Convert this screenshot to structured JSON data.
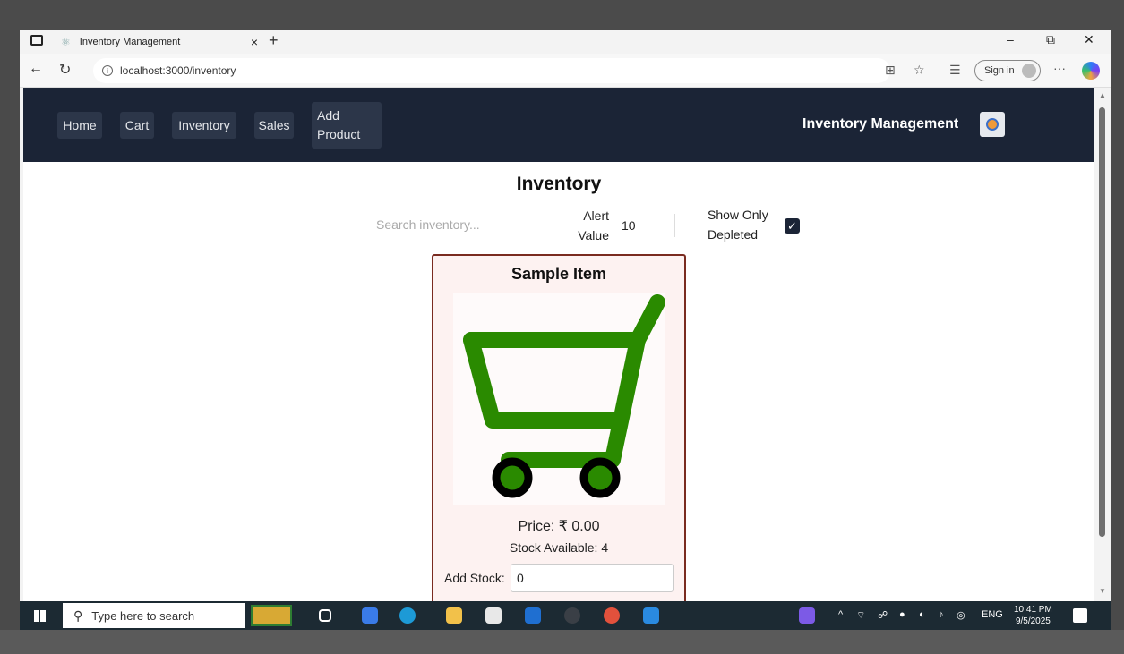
{
  "browser": {
    "tab_title": "Inventory Management",
    "tab_close": "×",
    "new_tab": "+",
    "url": "localhost:3000/inventory",
    "sign_in": "Sign in",
    "more": "···",
    "minimize": "–",
    "restore": "⧉",
    "close": "✕"
  },
  "nav": {
    "items": [
      {
        "label": "Home"
      },
      {
        "label": "Cart"
      },
      {
        "label": "Inventory"
      },
      {
        "label": "Sales"
      },
      {
        "label_line1": "Add",
        "label_line2": "Product"
      }
    ],
    "brand": "Inventory Management"
  },
  "page": {
    "title": "Inventory",
    "search_placeholder": "Search inventory...",
    "alert_label_1": "Alert",
    "alert_label_2": "Value",
    "alert_value": "10",
    "depleted_label_1": "Show Only",
    "depleted_label_2": "Depleted",
    "depleted_checked": true
  },
  "card": {
    "title": "Sample Item",
    "image_icon": "shopping-cart",
    "cart_color": "#2a8a00",
    "price": "Price: ₹ 0.00",
    "stock": "Stock Available: 4",
    "add_stock_label": "Add Stock:",
    "add_stock_value": "0"
  },
  "taskbar": {
    "search_text": "Type here to search",
    "lang": "ENG",
    "time": "10:41 PM",
    "date": "9/5/2025"
  }
}
